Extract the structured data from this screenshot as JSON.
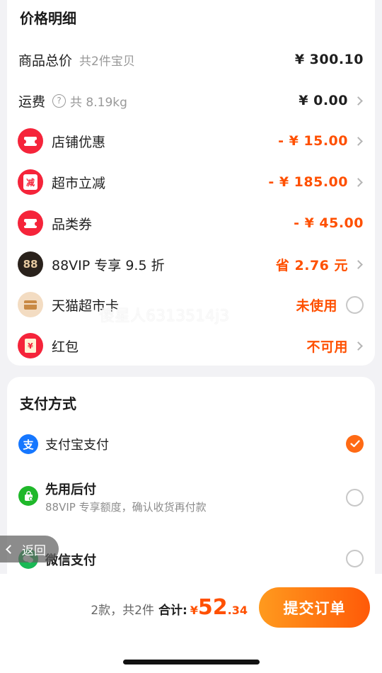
{
  "price_section": {
    "title": "价格明细",
    "total": {
      "label": "商品总价",
      "sub": "共2件宝贝",
      "value": "¥ 300.10"
    },
    "shipping": {
      "label": "运费",
      "sub": "共 8.19kg",
      "value": "¥ 0.00"
    },
    "store_discount": {
      "label": "店铺优惠",
      "value": "- ¥ 15.00"
    },
    "market_discount": {
      "label": "超市立减",
      "value": "- ¥ 185.00",
      "icon_text": "减"
    },
    "category_coupon": {
      "label": "品类券",
      "value": "- ¥ 45.00"
    },
    "vip": {
      "label": "88VIP 专享 9.5 折",
      "value": "省 2.76 元",
      "icon_text": "88"
    },
    "tmall_card": {
      "label": "天猫超市卡",
      "value": "未使用"
    },
    "red_packet": {
      "label": "红包",
      "value": "不可用",
      "icon_text": "¥"
    }
  },
  "watermark": "傻星人6313514j3",
  "payment_section": {
    "title": "支付方式",
    "alipay": {
      "label": "支付宝支付",
      "icon_text": "支"
    },
    "pay_later": {
      "label": "先用后付",
      "sub": "88VIP 专享额度，确认收货再付款"
    },
    "wechat": {
      "label": "微信支付"
    }
  },
  "back_button": {
    "label": "返回"
  },
  "bottom": {
    "count": "2款，共2件",
    "total_label": "合计:",
    "currency": "¥",
    "amount_int": "52",
    "amount_dec": ".34",
    "submit_label": "提交订单"
  },
  "colors": {
    "accent": "#ff5000",
    "red_icon": "#f5243a",
    "button_start": "#ff9a1e",
    "button_end": "#ff5a08"
  }
}
